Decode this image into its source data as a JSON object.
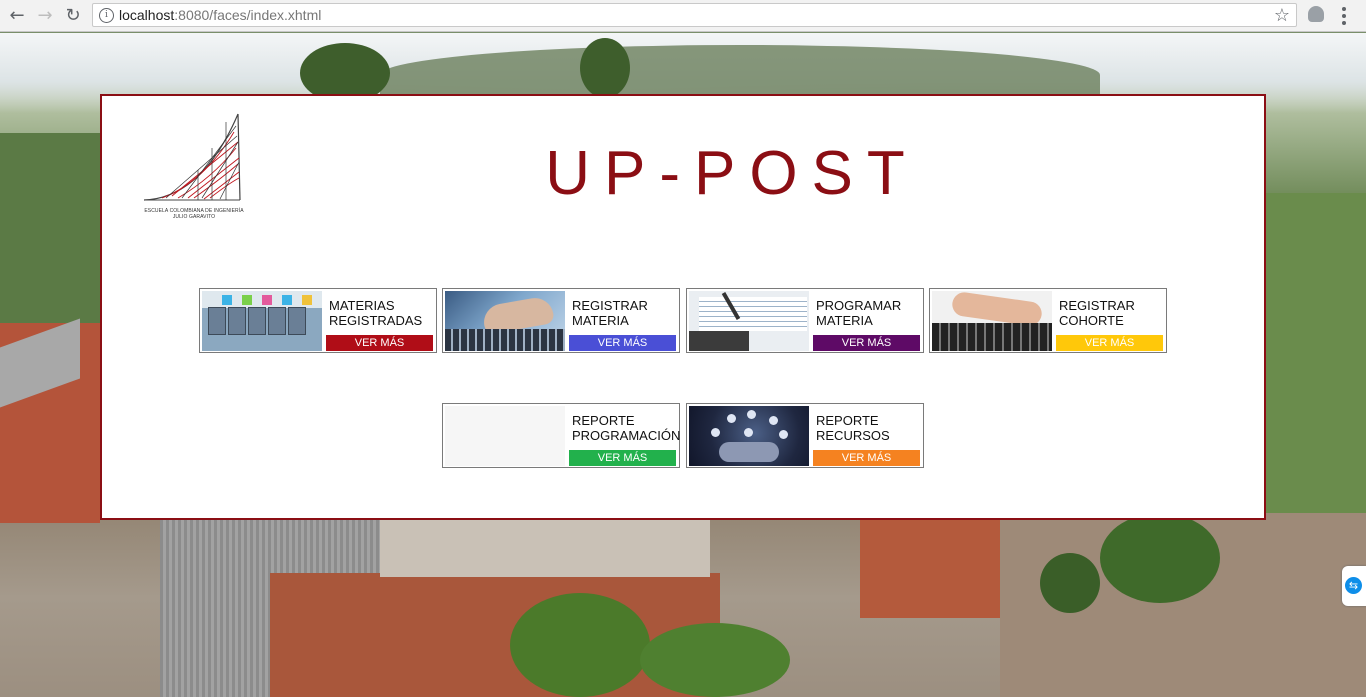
{
  "browser": {
    "url_host": "localhost",
    "url_path": ":8080/faces/index.xhtml"
  },
  "logo": {
    "line1": "ESCUELA COLOMBIANA DE INGENIERÍA",
    "line2": "JULIO GARAVITO"
  },
  "title": "UP-POST",
  "cards": [
    {
      "label": "MATERIAS\nREGISTRADAS",
      "button": "VER MÁS",
      "color": "#b00d17",
      "icon": "servers-image"
    },
    {
      "label": "REGISTRAR\nMATERIA",
      "button": "VER MÁS",
      "color": "#4a4fd6",
      "icon": "laptop-hand-image"
    },
    {
      "label": "PROGRAMAR\nMATERIA",
      "button": "VER MÁS",
      "color": "#5e0a66",
      "icon": "writing-image"
    },
    {
      "label": "REGISTRAR\nCOHORTE",
      "button": "VER MÁS",
      "color": "#ffc80a",
      "icon": "typing-image"
    },
    {
      "label": "REPORTE\nPROGRAMACIÓN",
      "button": "VER MÁS",
      "color": "#22b14c",
      "icon": "calendar-image"
    },
    {
      "label": "REPORTE\nRECURSOS",
      "button": "VER MÁS",
      "color": "#f58220",
      "icon": "network-image"
    }
  ]
}
